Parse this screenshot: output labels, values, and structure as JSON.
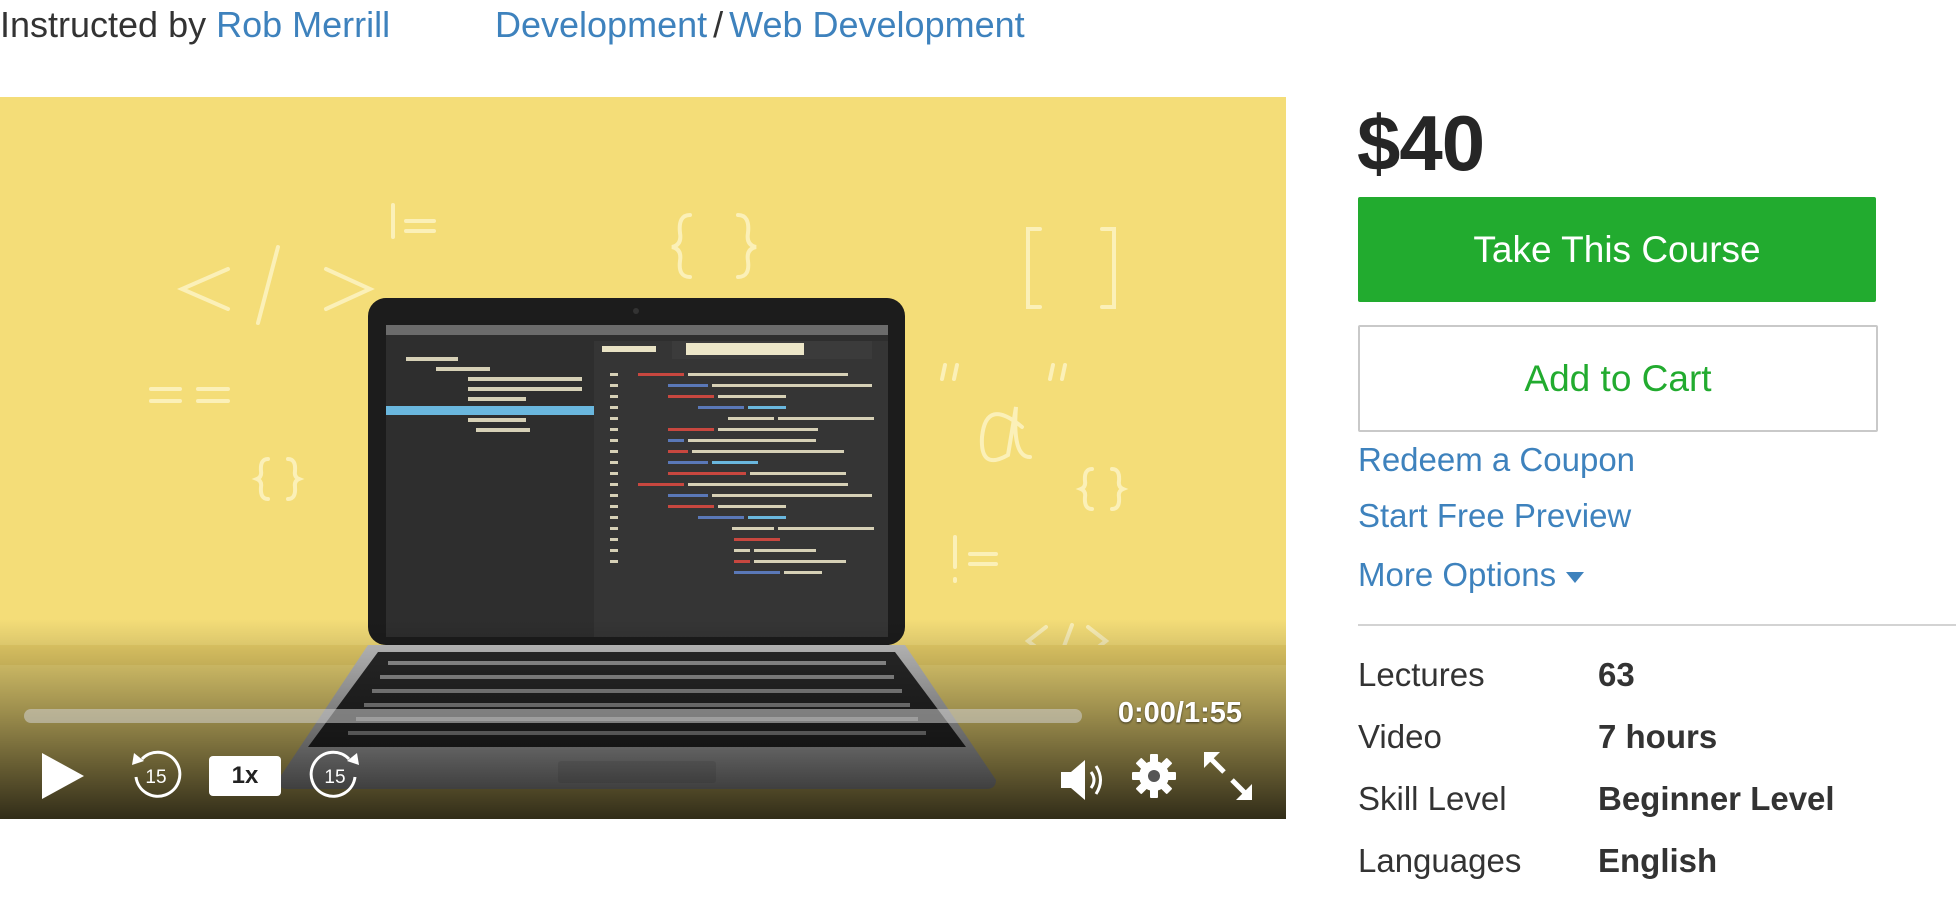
{
  "header": {
    "instructed_prefix": "Instructed by",
    "instructor": "Rob Merrill",
    "category": "Development",
    "separator": "/",
    "subcategory": "Web Development"
  },
  "player": {
    "time": "0:00/1:55",
    "speed": "1x",
    "rewind_seconds": "15",
    "forward_seconds": "15",
    "progress": 0,
    "icons": [
      "play-icon",
      "rewind-15-icon",
      "forward-15-icon",
      "volume-icon",
      "settings-gear-icon",
      "fullscreen-icon"
    ],
    "background_color": "#f4dd78"
  },
  "purchase": {
    "price": "$40",
    "take_course": "Take This Course",
    "add_to_cart": "Add to Cart",
    "redeem_coupon": "Redeem a Coupon",
    "free_preview": "Start Free Preview",
    "more_options": "More Options",
    "primary_color": "#22ab2f",
    "link_color": "#3e82bd"
  },
  "details": [
    {
      "label": "Lectures",
      "value": "63"
    },
    {
      "label": "Video",
      "value": "7 hours"
    },
    {
      "label": "Skill Level",
      "value": "Beginner Level"
    },
    {
      "label": "Languages",
      "value": "English"
    }
  ]
}
